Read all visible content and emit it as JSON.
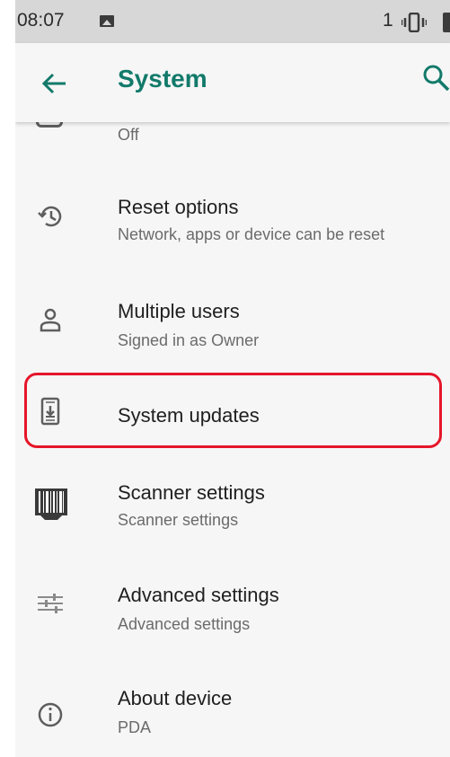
{
  "status_bar": {
    "time": "08:07",
    "notification_count": "1"
  },
  "app_bar": {
    "title": "System"
  },
  "partial_item": {
    "subtitle": "Off"
  },
  "items": [
    {
      "title": "Reset options",
      "subtitle": "Network, apps or device can be reset",
      "icon": "reset-history-icon"
    },
    {
      "title": "Multiple users",
      "subtitle": "Signed in as Owner",
      "icon": "person-icon"
    },
    {
      "title": "System updates",
      "subtitle": "",
      "icon": "system-update-icon"
    },
    {
      "title": "Scanner settings",
      "subtitle": "Scanner settings",
      "icon": "barcode-scanner-icon"
    },
    {
      "title": "Advanced settings",
      "subtitle": "Advanced settings",
      "icon": "sliders-icon"
    },
    {
      "title": "About device",
      "subtitle": "PDA",
      "icon": "info-icon"
    }
  ],
  "highlight": {
    "color": "#e5162a",
    "target": "System updates"
  },
  "colors": {
    "accent": "#127a6a",
    "status_bar": "#d7d7d7",
    "background": "#f6f6f6"
  }
}
